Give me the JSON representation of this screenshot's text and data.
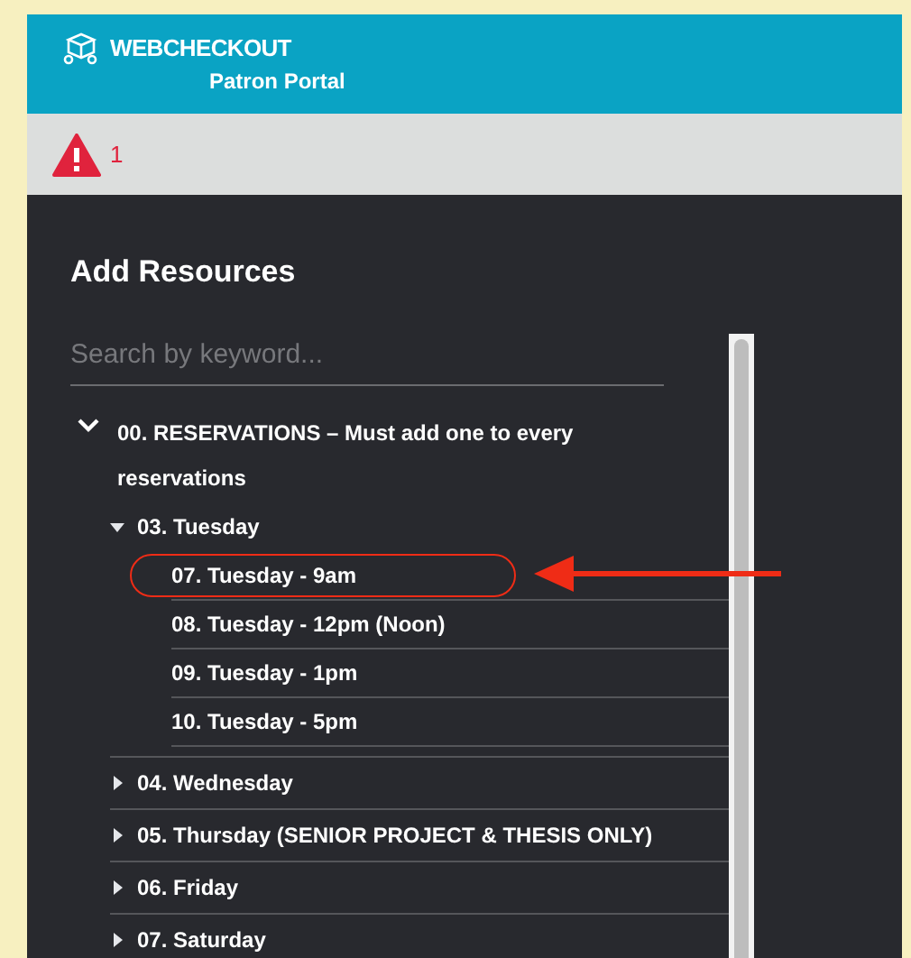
{
  "header": {
    "brand": "WEBCHECKOUT",
    "subtitle": "Patron Portal"
  },
  "alerts": {
    "count": "1"
  },
  "panel": {
    "title": "Add Resources",
    "search": {
      "placeholder": "Search by keyword..."
    },
    "tree": [
      {
        "label": "00. RESERVATIONS – Must add one to every reservations",
        "expanded": true,
        "children": [
          {
            "label": "03. Tuesday",
            "expanded": true,
            "children": [
              {
                "label": "07. Tuesday - 9am",
                "annotated": true
              },
              {
                "label": "08. Tuesday - 12pm (Noon)",
                "annotated": false
              },
              {
                "label": "09. Tuesday - 1pm",
                "annotated": false
              },
              {
                "label": "10. Tuesday - 5pm",
                "annotated": false
              }
            ]
          },
          {
            "label": "04. Wednesday",
            "expanded": false
          },
          {
            "label": "05. Thursday (SENIOR PROJECT & THESIS ONLY)",
            "expanded": false
          },
          {
            "label": "06. Friday",
            "expanded": false
          },
          {
            "label": "07. Saturday",
            "expanded": false
          }
        ]
      }
    ]
  }
}
